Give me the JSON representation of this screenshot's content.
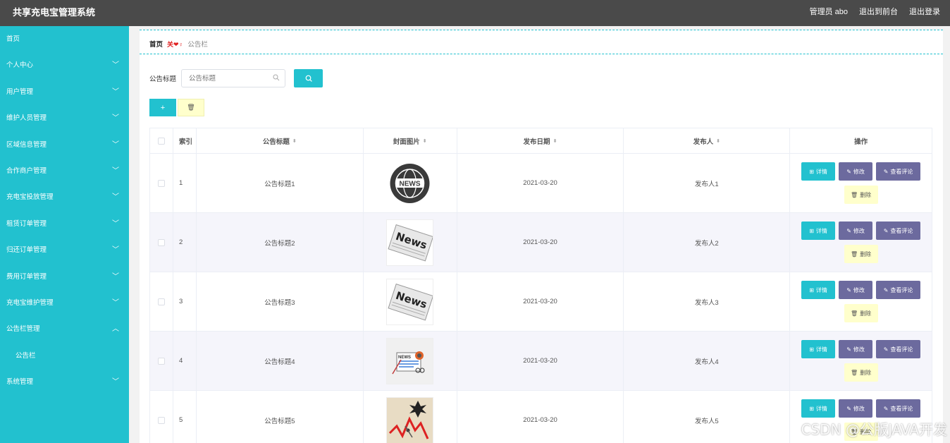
{
  "header": {
    "title": "共享充电宝管理系统",
    "user": "管理员 abo",
    "to_front": "退出到前台",
    "logout": "退出登录"
  },
  "sidebar": {
    "items": [
      {
        "label": "首页",
        "expandable": false
      },
      {
        "label": "个人中心",
        "expandable": true,
        "chevron": "﹀"
      },
      {
        "label": "用户管理",
        "expandable": true,
        "chevron": "﹀"
      },
      {
        "label": "维护人员管理",
        "expandable": true,
        "chevron": "﹀"
      },
      {
        "label": "区域信息管理",
        "expandable": true,
        "chevron": "﹀"
      },
      {
        "label": "合作商户管理",
        "expandable": true,
        "chevron": "﹀"
      },
      {
        "label": "充电宝投放管理",
        "expandable": true,
        "chevron": "﹀"
      },
      {
        "label": "租赁订单管理",
        "expandable": true,
        "chevron": "﹀"
      },
      {
        "label": "归还订单管理",
        "expandable": true,
        "chevron": "﹀"
      },
      {
        "label": "费用订单管理",
        "expandable": true,
        "chevron": "﹀"
      },
      {
        "label": "充电宝维护管理",
        "expandable": true,
        "chevron": "﹀"
      },
      {
        "label": "公告栏管理",
        "expandable": true,
        "chevron": "︿"
      },
      {
        "label": "公告栏",
        "expandable": false,
        "sub": true
      },
      {
        "label": "系统管理",
        "expandable": true,
        "chevron": "﹀"
      }
    ]
  },
  "breadcrumb": {
    "home": "首页",
    "separator": "关❤♀",
    "current": "公告栏"
  },
  "search": {
    "label": "公告标题",
    "placeholder": "公告标题",
    "search_icon": "search-icon"
  },
  "actions": {
    "add_icon": "+",
    "delete_icon": "🗑"
  },
  "table": {
    "headers": {
      "index": "索引",
      "title": "公告标题",
      "cover": "封面图片",
      "date": "发布日期",
      "publisher": "发布人",
      "ops": "操作"
    },
    "sort_glyph": "⬍",
    "rows": [
      {
        "index": "1",
        "title": "公告标题1",
        "cover": "news-globe-icon",
        "date": "2021-03-20",
        "publisher": "发布人1"
      },
      {
        "index": "2",
        "title": "公告标题2",
        "cover": "newspaper-icon",
        "date": "2021-03-20",
        "publisher": "发布人2"
      },
      {
        "index": "3",
        "title": "公告标题3",
        "cover": "newspaper-icon",
        "date": "2021-03-20",
        "publisher": "发布人3"
      },
      {
        "index": "4",
        "title": "公告标题4",
        "cover": "news-paper-desk-icon",
        "date": "2021-03-20",
        "publisher": "发布人4"
      },
      {
        "index": "5",
        "title": "公告标题5",
        "cover": "falling-chart-icon",
        "date": "2021-03-20",
        "publisher": "发布人5"
      }
    ],
    "buttons": {
      "detail": "详情",
      "edit": "修改",
      "comment": "查看评论",
      "delete": "删除"
    }
  },
  "colors": {
    "accent": "#22c1cf",
    "topbar": "#4a4a4a",
    "purple_button": "#6c6a9e",
    "delete_button": "#ffffcc"
  },
  "watermark": "CSDN @公版JAVA开发"
}
